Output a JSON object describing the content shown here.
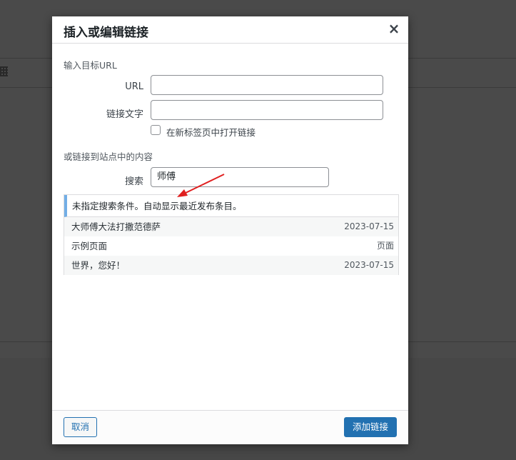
{
  "dialog": {
    "title": "插入或编辑链接",
    "close_symbol": "×"
  },
  "url_section": {
    "heading": "输入目标URL",
    "url_label": "URL",
    "url_value": "",
    "link_text_label": "链接文字",
    "link_text_value": "",
    "new_tab_label": "在新标签页中打开链接",
    "new_tab_checked": false
  },
  "search_section": {
    "heading": "或链接到站点中的内容",
    "search_label": "搜索",
    "search_value": "师傅",
    "notice": "未指定搜索条件。自动显示最近发布条目。",
    "results": [
      {
        "title": "大师傅大法打撒范德萨",
        "meta": "2023-07-15"
      },
      {
        "title": "示例页面",
        "meta": "页面"
      },
      {
        "title": "世界，您好！",
        "meta": "2023-07-15"
      }
    ]
  },
  "footer": {
    "cancel_label": "取消",
    "submit_label": "添加链接"
  },
  "colors": {
    "accent": "#2271b1",
    "notice_border": "#72aee6",
    "annotation_arrow": "#e02020"
  }
}
